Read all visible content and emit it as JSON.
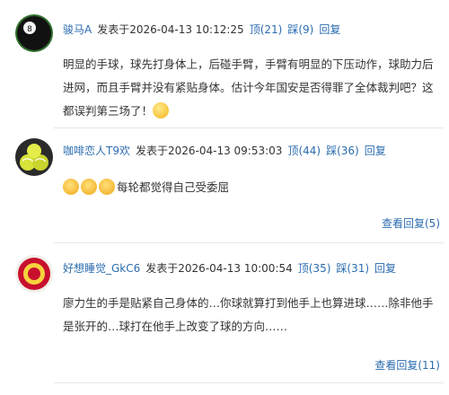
{
  "comments": [
    {
      "user": "骏马A",
      "posted_label": "发表于",
      "time": "2026-04-13 10:12:25",
      "up_label": "顶",
      "up_count": "(21)",
      "down_label": "踩",
      "down_count": "(9)",
      "reply_label": "回复",
      "text": "明显的手球，球先打身体上，后碰手臂，手臂有明显的下压动作，球助力后进网，而且手臂并没有紧贴身体。估计今年国安是否得罪了全体裁判吧？这都误判第三场了！",
      "avatar_icon": "billiard-ball-8-avatar",
      "emoji_icon": "wink-emoji"
    },
    {
      "user": "咖啡恋人T9欢",
      "posted_label": "发表于",
      "time": "2026-04-13 09:53:03",
      "up_label": "顶",
      "up_count": "(44)",
      "down_label": "踩",
      "down_count": "(36)",
      "reply_label": "回复",
      "text": "每轮都觉得自己受委屈",
      "avatar_icon": "tennis-balls-avatar",
      "emoji_icon": "crying-emoji",
      "view_replies": "查看回复(5)"
    },
    {
      "user": "好想睡觉_GkC6",
      "posted_label": "发表于",
      "time": "2026-04-13 10:00:54",
      "up_label": "顶",
      "up_count": "(35)",
      "down_label": "踩",
      "down_count": "(31)",
      "reply_label": "回复",
      "text": "廖力生的手是贴紧自己身体的…你球就算打到他手上也算进球……除非他手是张开的…球打在他手上改变了球的方向……",
      "avatar_icon": "team-crest-avatar",
      "view_replies": "查看回复(11)"
    }
  ],
  "colors": {
    "link": "#2b6cb0",
    "text": "#333333",
    "divider": "#e6e6e6"
  }
}
